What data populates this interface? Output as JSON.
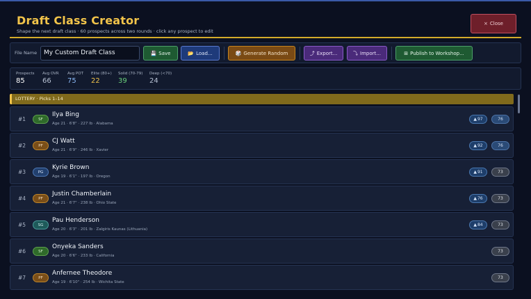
{
  "header": {
    "title": "Draft Class Creator",
    "subtitle": "Shape the next draft class · 60 prospects across two rounds · click any prospect to edit",
    "close_label": "Close",
    "close_icon": "×"
  },
  "toolbar": {
    "file_name_label": "File Name",
    "file_name_value": "My Custom Draft Class",
    "save_label": "Save",
    "load_label": "Load...",
    "generate_label": "Generate Random",
    "export_label": "Export...",
    "import_label": "Import...",
    "publish_label": "Publish to Workshop...",
    "save_icon": "💾",
    "load_icon": "📂",
    "generate_icon": "🎲",
    "export_icon": "⤴",
    "import_icon": "⤵",
    "publish_icon": "⊞"
  },
  "stats": [
    {
      "label": "Prospects",
      "value": "85",
      "color": "#ffffff"
    },
    {
      "label": "Avg OVR",
      "value": "66",
      "color": "#b8c2d4"
    },
    {
      "label": "Avg POT",
      "value": "75",
      "color": "#8ab8f6"
    },
    {
      "label": "Elite (80+)",
      "value": "22",
      "color": "#f2c44a"
    },
    {
      "label": "Solid (70-79)",
      "value": "39",
      "color": "#6ad07a"
    },
    {
      "label": "Deep (<70)",
      "value": "24",
      "color": "#b8c2d4"
    }
  ],
  "section": {
    "label": "LOTTERY · Picks 1–14"
  },
  "prospects": [
    {
      "rank": "#1",
      "pos": "SF",
      "name": "Ilya Bing",
      "meta": "Age 21 · 6'8\" · 227 lb · Alabama",
      "pot": "97",
      "ovr": "76",
      "ovr_style": "hi"
    },
    {
      "rank": "#2",
      "pos": "PF",
      "name": "CJ Watt",
      "meta": "Age 21 · 6'9\" · 246 lb · Xavier",
      "pot": "92",
      "ovr": "76",
      "ovr_style": "hi"
    },
    {
      "rank": "#3",
      "pos": "PG",
      "name": "Kyrie Brown",
      "meta": "Age 19 · 6'1\" · 197 lb · Oregon",
      "pot": "91",
      "ovr": "73",
      "ovr_style": "mid"
    },
    {
      "rank": "#4",
      "pos": "PF",
      "name": "Justin Chamberlain",
      "meta": "Age 21 · 6'7\" · 238 lb · Ohio State",
      "pot": "76",
      "ovr": "73",
      "ovr_style": "mid"
    },
    {
      "rank": "#5",
      "pos": "SG",
      "name": "Pau Henderson",
      "meta": "Age 20 · 6'3\" · 201 lb · Zalgiris Kaunas (Lithuania)",
      "pot": "84",
      "ovr": "73",
      "ovr_style": "mid"
    },
    {
      "rank": "#6",
      "pos": "SF",
      "name": "Onyeka Sanders",
      "meta": "Age 20 · 6'6\" · 233 lb · California",
      "pot": null,
      "ovr": "73",
      "ovr_style": "mid"
    },
    {
      "rank": "#7",
      "pos": "PF",
      "name": "Anfernee Theodore",
      "meta": "Age 19 · 6'10\" · 254 lb · Wichita State",
      "pot": null,
      "ovr": "73",
      "ovr_style": "mid"
    }
  ],
  "pot_icon": "▲"
}
